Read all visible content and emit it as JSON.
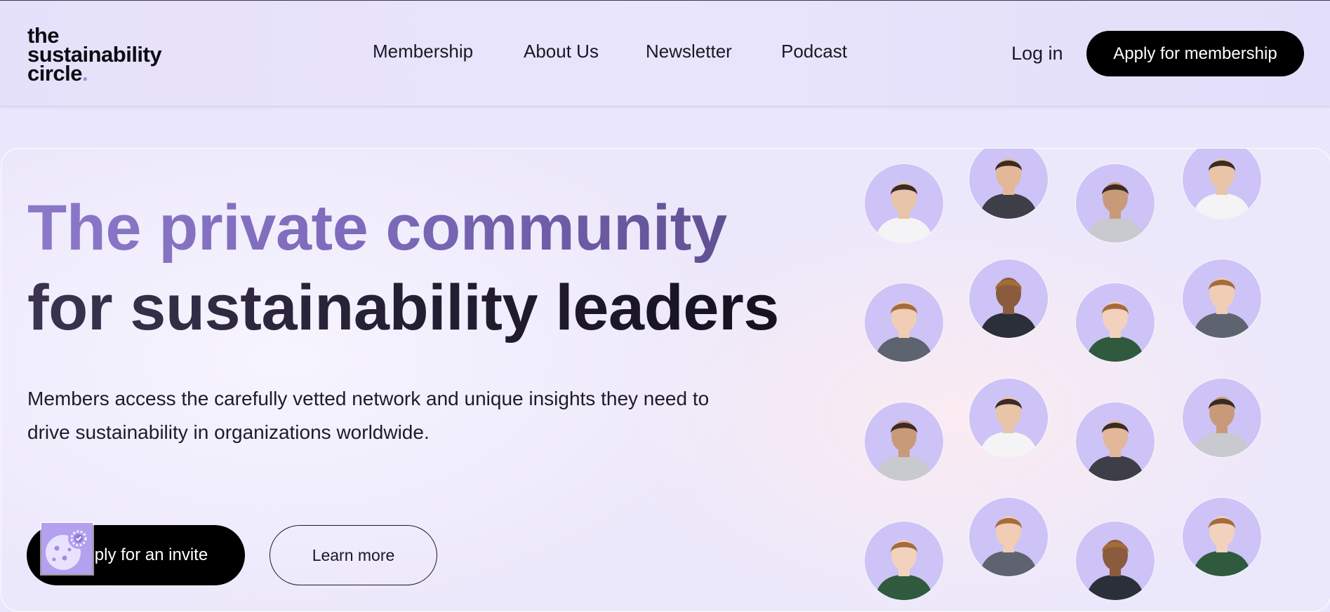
{
  "logo": {
    "line1": "the",
    "line2": "sustainability",
    "line3": "circle",
    "dot": "."
  },
  "nav": {
    "items": [
      "Membership",
      "About Us",
      "Newsletter",
      "Podcast"
    ]
  },
  "header": {
    "login": "Log in",
    "apply": "Apply for membership"
  },
  "hero": {
    "headline_line1": "The private community",
    "headline_line2": "for sustainability leaders",
    "subtext_line1": "Members access the carefully vetted network and unique insights they need to",
    "subtext_line2": "drive sustainability in organizations worldwide.",
    "primary_button": "ply for an invite",
    "secondary_button": "Learn more"
  },
  "members": {
    "count_shown": 16,
    "icon": "member-avatar-icon"
  },
  "cookie_widget": {
    "icon": "cookie-settings-icon"
  },
  "colors": {
    "accent": "#9b8ae6",
    "avatar_bg": "#cdc3f6",
    "button": "#000000"
  }
}
